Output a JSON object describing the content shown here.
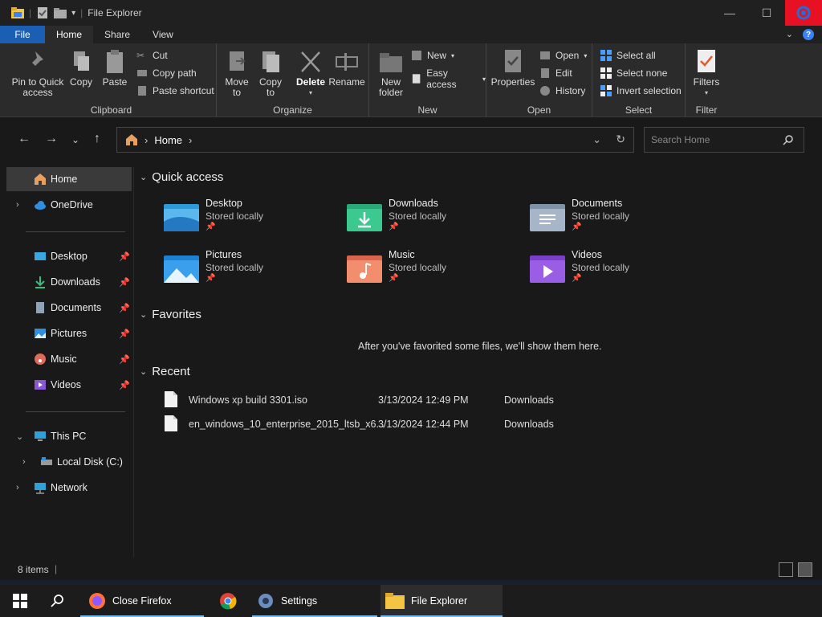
{
  "window": {
    "title": "File Explorer"
  },
  "ribbon_tabs": [
    {
      "label": "File"
    },
    {
      "label": "Home"
    },
    {
      "label": "Share"
    },
    {
      "label": "View"
    }
  ],
  "ribbon": {
    "clipboard": {
      "label": "Clipboard",
      "pin_to_quick_access": "Pin to Quick access",
      "copy": "Copy",
      "paste": "Paste",
      "cut": "Cut",
      "copy_path": "Copy path",
      "paste_shortcut": "Paste shortcut"
    },
    "organize": {
      "label": "Organize",
      "move_to": "Move to",
      "copy_to": "Copy to",
      "delete": "Delete",
      "rename": "Rename"
    },
    "new": {
      "label": "New",
      "new_folder": "New folder",
      "new_item": "New",
      "easy_access": "Easy access"
    },
    "open": {
      "label": "Open",
      "properties": "Properties",
      "open": "Open",
      "edit": "Edit",
      "history": "History"
    },
    "select": {
      "label": "Select",
      "select_all": "Select all",
      "select_none": "Select none",
      "invert_selection": "Invert selection"
    },
    "filter": {
      "label": "Filter",
      "filters": "Filters"
    }
  },
  "address": {
    "crumb": "Home"
  },
  "search": {
    "placeholder": "Search Home"
  },
  "nav_pane": {
    "home": "Home",
    "onedrive": "OneDrive",
    "desktop": "Desktop",
    "downloads": "Downloads",
    "documents": "Documents",
    "pictures": "Pictures",
    "music": "Music",
    "videos": "Videos",
    "this_pc": "This PC",
    "local_disk": "Local Disk (C:)",
    "network": "Network"
  },
  "quick_access": {
    "heading": "Quick access",
    "items": [
      {
        "name": "Desktop",
        "status": "Stored locally"
      },
      {
        "name": "Downloads",
        "status": "Stored locally"
      },
      {
        "name": "Documents",
        "status": "Stored locally"
      },
      {
        "name": "Pictures",
        "status": "Stored locally"
      },
      {
        "name": "Music",
        "status": "Stored locally"
      },
      {
        "name": "Videos",
        "status": "Stored locally"
      }
    ]
  },
  "favorites": {
    "heading": "Favorites",
    "empty_message": "After you've favorited some files, we'll show them here."
  },
  "recent": {
    "heading": "Recent",
    "items": [
      {
        "name": "Windows xp build 3301.iso",
        "date": "3/13/2024 12:49 PM",
        "location": "Downloads"
      },
      {
        "name": "en_windows_10_enterprise_2015_ltsb_x6...",
        "date": "3/13/2024 12:44 PM",
        "location": "Downloads"
      }
    ]
  },
  "status": {
    "item_count": "8 items"
  },
  "taskbar": {
    "firefox": "Close Firefox",
    "settings": "Settings",
    "explorer": "File Explorer"
  },
  "colors": {
    "accent": "#1a5fb4",
    "close": "#e81123"
  }
}
